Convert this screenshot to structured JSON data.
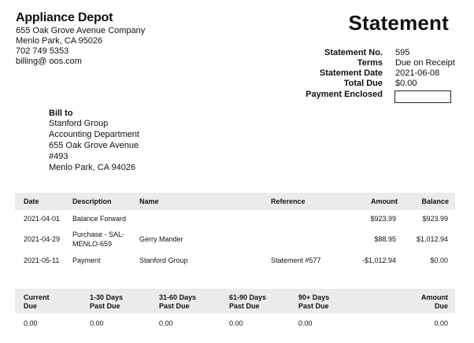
{
  "company": {
    "name": "Appliance Depot",
    "address_lines": [
      "655 Oak Grove Avenue Company",
      "Menlo Park, CA 95026",
      "702 749 5353",
      "billing@ oos.com"
    ]
  },
  "document": {
    "title": "Statement",
    "meta": [
      {
        "label": "Statement No.",
        "value": "595"
      },
      {
        "label": "Terms",
        "value": "Due on Receipt"
      },
      {
        "label": "Statement Date",
        "value": "2021-06-08"
      },
      {
        "label": "Total Due",
        "value": "$0.00"
      },
      {
        "label": "Payment Enclosed",
        "value": ""
      }
    ]
  },
  "bill_to": {
    "title": "Bill to",
    "lines": [
      "Stanford Group",
      "Accounting Department",
      "655 Oak Grove Avenue",
      "#493",
      "Menlo Park, CA 94026"
    ]
  },
  "transactions": {
    "headers": [
      "Date",
      "Description",
      "Name",
      "Reference",
      "Amount",
      "Balance"
    ],
    "rows": [
      {
        "date": "2021-04-01",
        "description": "Balance Forward",
        "description2": "",
        "name": "",
        "reference": "",
        "amount": "$923.99",
        "balance": "$923.99"
      },
      {
        "date": "2021-04-29",
        "description": "Purchase - SAL-",
        "description2": "MENLO-659",
        "name": "Gerry Mander",
        "reference": "",
        "amount": "$88.95",
        "balance": "$1,012.94"
      },
      {
        "date": "2021-05-11",
        "description": "Payment",
        "description2": "",
        "name": "Stanford Group",
        "reference": "Statement #577",
        "amount": "-$1,012.94",
        "balance": "$0.00"
      }
    ]
  },
  "aging": {
    "headers": [
      {
        "line1": "Current",
        "line2": "Due"
      },
      {
        "line1": "1-30 Days",
        "line2": "Past Due"
      },
      {
        "line1": "31-60 Days",
        "line2": "Past Due"
      },
      {
        "line1": "61-90 Days",
        "line2": "Past Due"
      },
      {
        "line1": "90+ Days",
        "line2": "Past Due"
      },
      {
        "line1": "Amount",
        "line2": "Due"
      }
    ],
    "values": [
      "0.00",
      "0.00",
      "0.00",
      "0.00",
      "0.00",
      "0.00"
    ]
  }
}
